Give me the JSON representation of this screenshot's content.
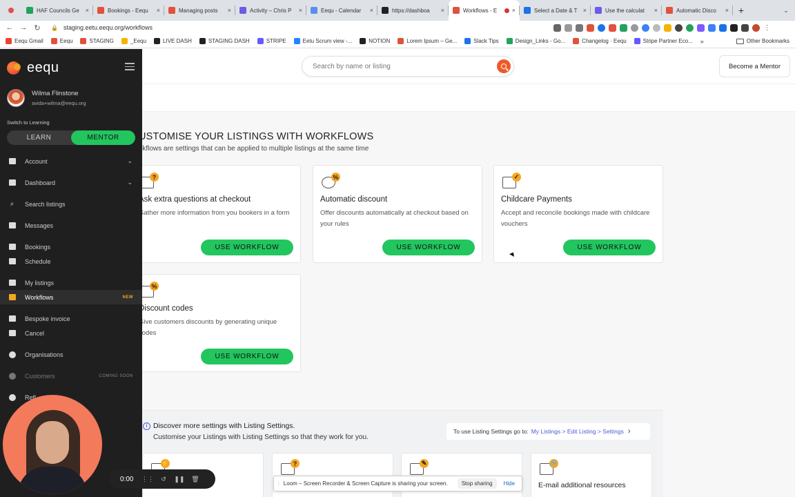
{
  "browser": {
    "tabs": [
      {
        "title": "HAF Councils Ge",
        "color": "#22a35a"
      },
      {
        "title": "Bookings - Eequ",
        "color": "#e0523b"
      },
      {
        "title": "Managing posts",
        "color": "#e0523b"
      },
      {
        "title": "Activity – Chris P",
        "color": "#6c5ce7"
      },
      {
        "title": "Eequ - Calendar",
        "color": "#5b8def"
      },
      {
        "title": "https://dashboa",
        "color": "#222222"
      },
      {
        "title": "Workflows - E",
        "color": "#e0523b",
        "active": true
      },
      {
        "title": "Select a Date & T",
        "color": "#1a73e8"
      },
      {
        "title": "Use the calculat",
        "color": "#6c5ce7"
      },
      {
        "title": "Automatic Disco",
        "color": "#e0523b"
      }
    ],
    "url": "staging.eetu.eequ.org/workflows",
    "bookmarks": [
      {
        "label": "Eequ Gmail",
        "color": "#ea4335"
      },
      {
        "label": "Eequ",
        "color": "#e0523b"
      },
      {
        "label": "STAGING",
        "color": "#e0523b"
      },
      {
        "label": "_Eequ",
        "color": "#f4b400"
      },
      {
        "label": "LIVE DASH",
        "color": "#222222"
      },
      {
        "label": "STAGING DASH",
        "color": "#222222"
      },
      {
        "label": "STRIPE",
        "color": "#635bff"
      },
      {
        "label": "Eetu Scrum view -...",
        "color": "#2684ff"
      },
      {
        "label": "NOTION",
        "color": "#222222"
      },
      {
        "label": "Lorem Ipsum – Ge...",
        "color": "#e0523b"
      },
      {
        "label": "Slack Tips",
        "color": "#1a73e8"
      },
      {
        "label": "Design_Links - Go...",
        "color": "#22a35a"
      },
      {
        "label": "Changelog · Eequ",
        "color": "#e0523b"
      },
      {
        "label": "Stripe Partner Eco...",
        "color": "#635bff"
      }
    ],
    "other_bookmarks": "Other Bookmarks"
  },
  "sidebar": {
    "brand": "eequ",
    "user_name": "Wilma Flinstone",
    "user_email": "avida+wilma@eequ.org",
    "switch_label": "Switch to Learning",
    "toggle": {
      "learn": "LEARN",
      "mentor": "MENTOR"
    },
    "items": [
      {
        "label": "Account",
        "icon": "account-icon"
      },
      {
        "label": "Dashboard",
        "icon": "dashboard-icon"
      },
      {
        "label": "Search listings",
        "icon": "search-icon"
      },
      {
        "label": "Messages",
        "icon": "messages-icon"
      },
      {
        "label": "Bookings",
        "icon": "bookings-icon"
      },
      {
        "label": "Schedule",
        "icon": "calendar-icon"
      },
      {
        "label": "My listings",
        "icon": "listings-icon"
      },
      {
        "label": "Workflows",
        "icon": "workflows-icon",
        "badge": "NEW"
      },
      {
        "label": "Bespoke invoice",
        "icon": "invoice-icon"
      },
      {
        "label": "Cancel",
        "icon": "cancel-icon"
      },
      {
        "label": "Organisations",
        "icon": "globe-icon"
      },
      {
        "label": "Customers",
        "icon": "customers-icon",
        "badge": "COMING SOON"
      },
      {
        "label": "Refl",
        "icon": "apple-icon"
      }
    ]
  },
  "header": {
    "search_placeholder": "Search by name or listing",
    "become_mentor": "Become a Mentor"
  },
  "main": {
    "title": "USTOMISE YOUR LISTINGS WITH WORKFLOWS",
    "subtitle": "rkflows are settings that can be applied to multiple listings at the same time",
    "cards": [
      {
        "title": "Ask extra questions at checkout",
        "desc": "Gather more information from you bookers in a form",
        "badge": "?",
        "button": "USE WORKFLOW"
      },
      {
        "title": "Automatic discount",
        "desc": "Offer discounts automatically at checkout based on your rules",
        "badge": "%",
        "button": "USE WORKFLOW"
      },
      {
        "title": "Childcare Payments",
        "desc": "Accept and reconcile bookings made with childcare vouchers",
        "badge": "✓",
        "button": "USE WORKFLOW"
      },
      {
        "title": "Discount codes",
        "desc": "Give customers discounts by generating unique codes",
        "badge": "%",
        "button": "USE WORKFLOW"
      }
    ],
    "info": {
      "heading": "Discover more settings with Listing Settings.",
      "sub": "Customise your Listings with Listing Settings so that they work for you.",
      "goto_prefix": "To use Listing Settings go to:",
      "goto_link": "My Listings > Edit Listing > Settings"
    },
    "mini_cards": [
      {
        "title": "",
        "badge": "⚡"
      },
      {
        "title": "",
        "badge": "?"
      },
      {
        "title": "",
        "badge": "✎"
      },
      {
        "title": "E-mail additional resources",
        "badge": "🔗"
      }
    ]
  },
  "loom": {
    "timer": "0:00",
    "share_text": "Loom – Screen Recorder & Screen Capture is sharing your screen.",
    "stop": "Stop sharing",
    "hide": "Hide"
  },
  "colors": {
    "accent": "#22c55e",
    "brand_orange": "#ef5a2a",
    "sidebar_bg": "#1f1f1f",
    "badge": "#f5a623"
  }
}
